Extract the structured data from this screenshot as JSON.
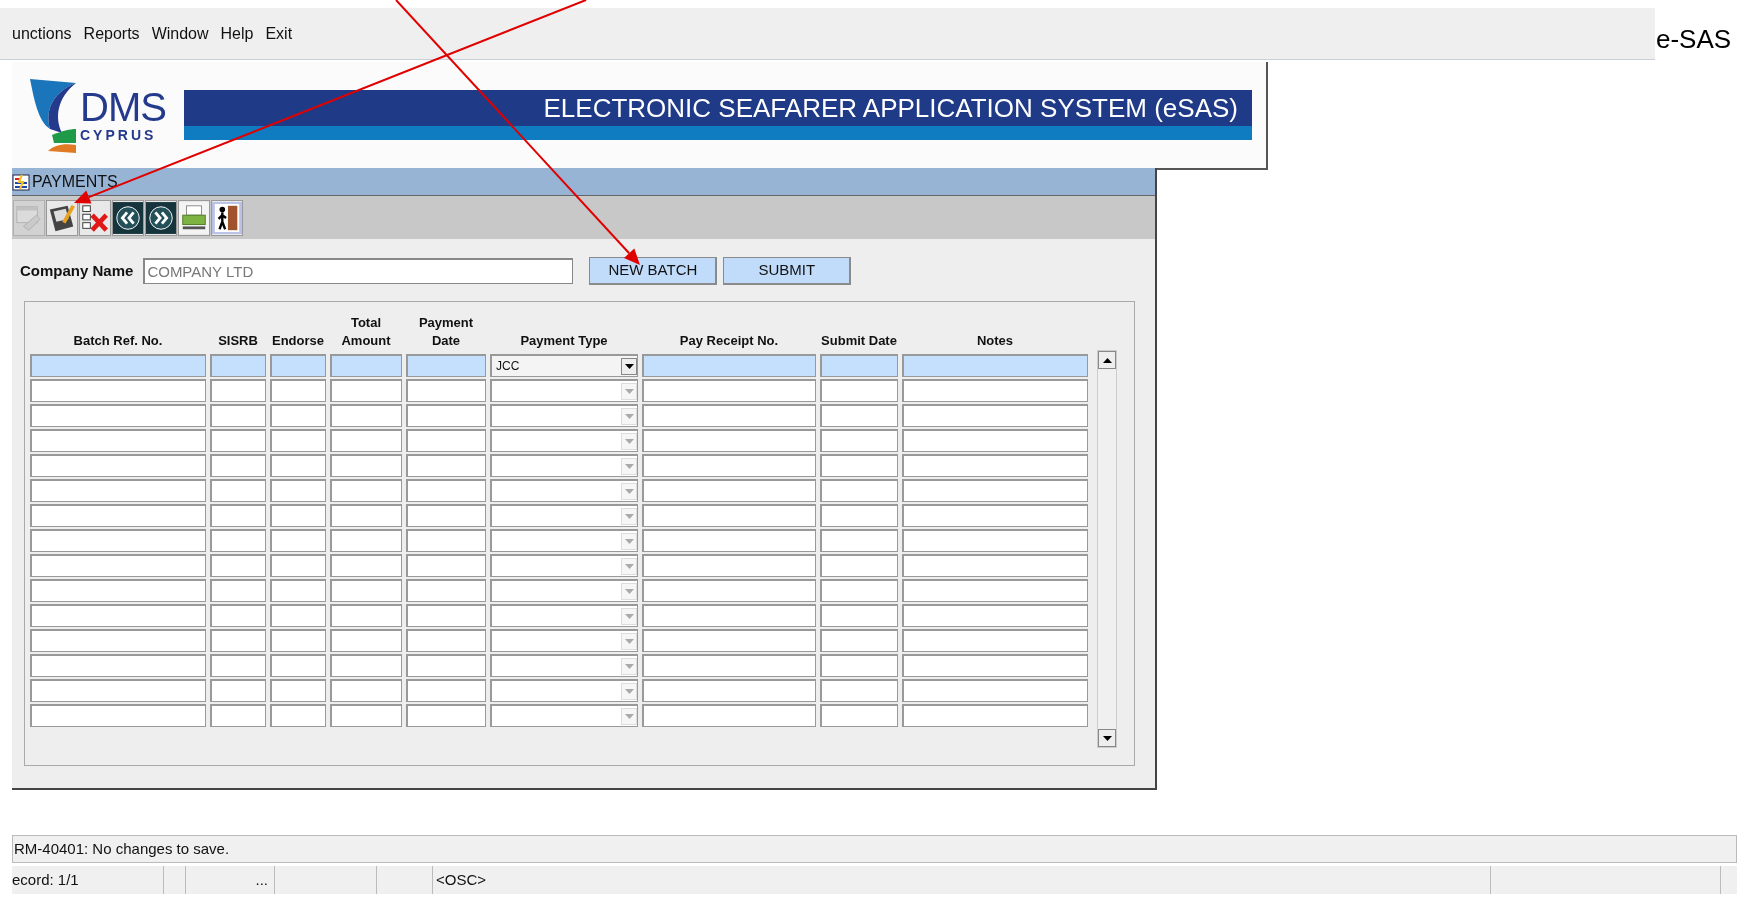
{
  "menu": [
    "unctions",
    "Reports",
    "Window",
    "Help",
    "Exit"
  ],
  "app_label": "e-SAS",
  "logo": {
    "name": "DMS",
    "sub": "CYPRUS"
  },
  "banner_title": "ELECTRONIC SEAFARER APPLICATION SYSTEM (eSAS)",
  "form": {
    "title": "PAYMENTS",
    "toolbar": [
      {
        "kind": "clear",
        "disabled": true
      },
      {
        "kind": "save",
        "disabled": false
      },
      {
        "kind": "delete",
        "disabled": false
      },
      {
        "kind": "previous",
        "disabled": false
      },
      {
        "kind": "next",
        "disabled": false
      },
      {
        "kind": "print",
        "disabled": false
      },
      {
        "kind": "exit",
        "disabled": false
      }
    ],
    "company_label": "Company Name",
    "company_value": "COMPANY LTD",
    "buttons": [
      "NEW BATCH",
      "SUBMIT"
    ],
    "columns": [
      "Batch Ref. No.",
      "SISRB",
      "Endorse",
      "Total Amount",
      "Payment Date",
      "Payment Type",
      "Pay Receipt No.",
      "Submit Date",
      "Notes"
    ],
    "rows": [
      {
        "selected": true,
        "payment_type": "JCC"
      },
      {
        "selected": false
      },
      {
        "selected": false
      },
      {
        "selected": false
      },
      {
        "selected": false
      },
      {
        "selected": false
      },
      {
        "selected": false
      },
      {
        "selected": false
      },
      {
        "selected": false
      },
      {
        "selected": false
      },
      {
        "selected": false
      },
      {
        "selected": false
      },
      {
        "selected": false
      },
      {
        "selected": false
      },
      {
        "selected": false
      }
    ]
  },
  "message": "RM-40401: No changes to save.",
  "status_bar": {
    "record": "ecord: 1/1",
    "ellipsis": "...",
    "mode": "<OSC>"
  },
  "annotations": [
    {
      "kind": "arrow"
    },
    {
      "kind": "arrow"
    }
  ]
}
